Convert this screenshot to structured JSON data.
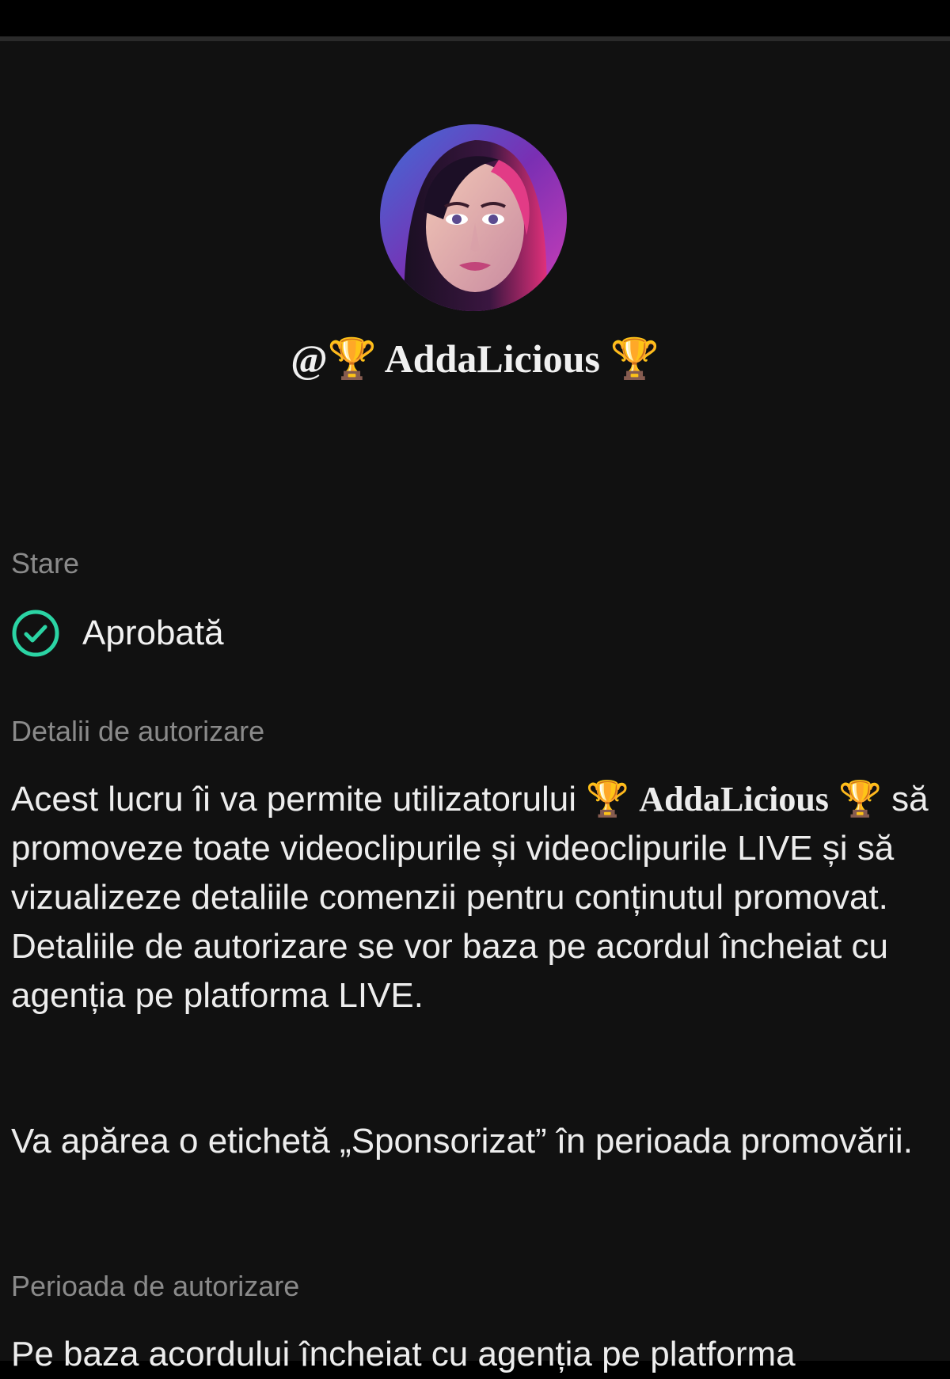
{
  "profile": {
    "username_prefix": "@🏆 ",
    "username": "AddaLicious",
    "username_suffix": " 🏆",
    "avatar_alt": "profile picture"
  },
  "status": {
    "label": "Stare",
    "value": "Aprobată",
    "icon": "check-circle-icon",
    "icon_color": "#2bd4a4"
  },
  "details": {
    "label": "Detalii de autorizare",
    "text_before_name": "Acest lucru îi va permite utilizatorului 🏆 ",
    "name": "AddaLicious",
    "text_after_name": " 🏆 să promoveze toate videoclipurile și videoclipurile LIVE și să vizualizeze detaliile comenzii pentru conținutul promovat. Detaliile de autorizare se vor baza pe acordul încheiat cu agenția pe platforma LIVE.",
    "sponsored_note": "Va apărea o etichetă „Sponsorizat” în perioada promovării."
  },
  "period": {
    "label": "Perioada de autorizare",
    "text": "Pe baza acordului încheiat cu agenția pe platforma"
  }
}
